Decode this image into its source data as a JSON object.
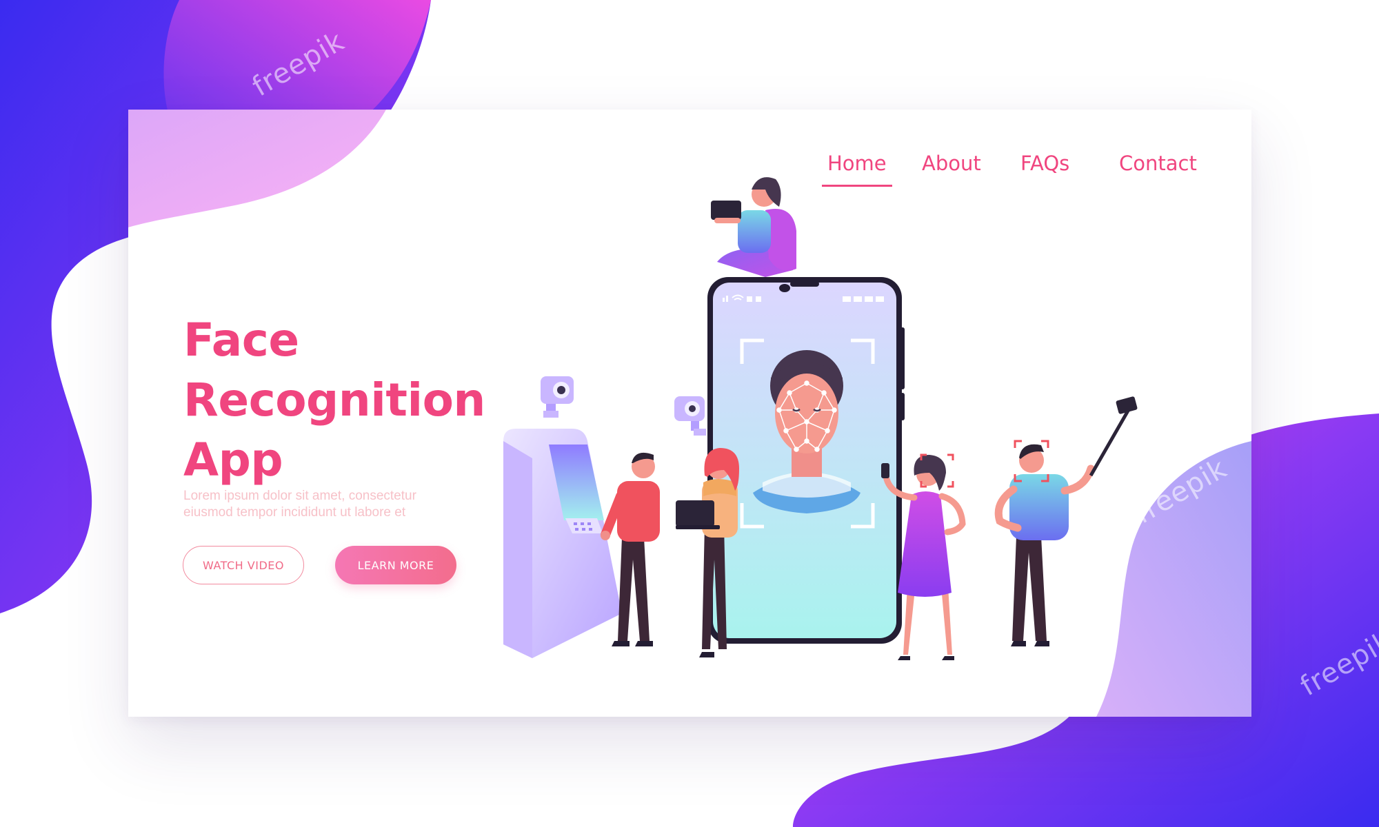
{
  "nav": {
    "items": [
      {
        "label": "Home",
        "active": true
      },
      {
        "label": "About",
        "active": false
      },
      {
        "label": "FAQs",
        "active": false
      },
      {
        "label": "Contact",
        "active": false
      }
    ]
  },
  "hero": {
    "title_lines": [
      "Face",
      "Recognition",
      "App"
    ],
    "description_lines": [
      "Lorem ipsum dolor sit amet, consectetur",
      "eiusmod tempor incididunt ut labore et"
    ],
    "watch_video_label": "WATCH VIDEO",
    "learn_more_label": "LEARN MORE"
  },
  "watermark": {
    "text": "freepik"
  },
  "colors": {
    "accent": "#f0457f",
    "blob_blue": "#3a2bf0",
    "blob_magenta": "#f046e8",
    "phone_screen_top": "#dcd6ff",
    "phone_screen_bottom": "#a9f3ee",
    "atm": "#c9b6ff"
  },
  "icons": [
    "camera-icon",
    "face-mesh-icon",
    "tablet-icon",
    "laptop-icon",
    "selfie-stick-icon",
    "wifi-icon",
    "signal-icon",
    "battery-icon"
  ]
}
